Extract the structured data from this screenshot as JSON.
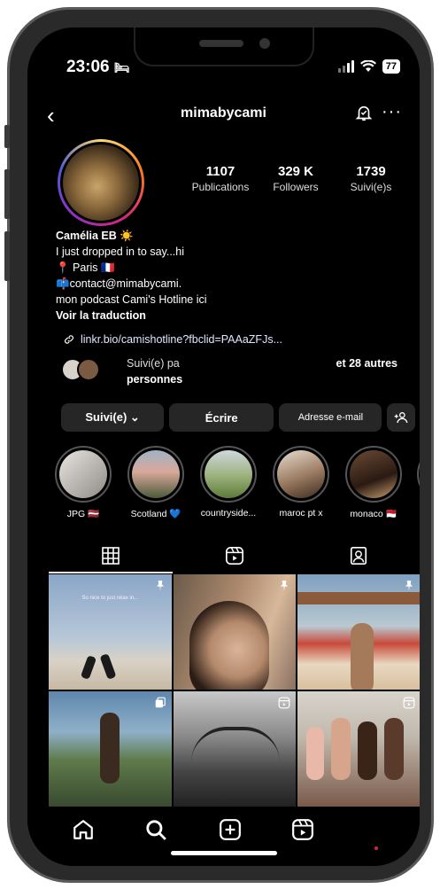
{
  "status": {
    "time": "23:06",
    "battery": "77"
  },
  "header": {
    "username": "mimabycami"
  },
  "stats": [
    {
      "num": "1107",
      "label": "Publications"
    },
    {
      "num": "329 K",
      "label": "Followers"
    },
    {
      "num": "1739",
      "label": "Suivi(e)s"
    }
  ],
  "bio": {
    "name": "Camélia EB ☀️",
    "line1": "I just dropped in to say...hi",
    "line2": "📍 Paris 🇫🇷",
    "line3": "📫contact@mimabycami.",
    "line4": "mon podcast Cami's Hotline ici",
    "translate": "Voir la traduction"
  },
  "link": {
    "text": "linkr.bio/camishotline?fbclid=PAAaZFJs..."
  },
  "followed_by": {
    "text": "Suivi(e) pa",
    "right": "et 28 autres",
    "line2": "personnes"
  },
  "buttons": {
    "following": "Suivi(e) ⌄",
    "message": "Écrire",
    "email": "Adresse e-mail"
  },
  "highlights": [
    {
      "label": "JPG 🇱🇻"
    },
    {
      "label": "Scotland 💙"
    },
    {
      "label": "countryside..."
    },
    {
      "label": "maroc pt x"
    },
    {
      "label": "monaco 🇲🇨"
    }
  ],
  "grid_caption": "So nice to just relax in..."
}
